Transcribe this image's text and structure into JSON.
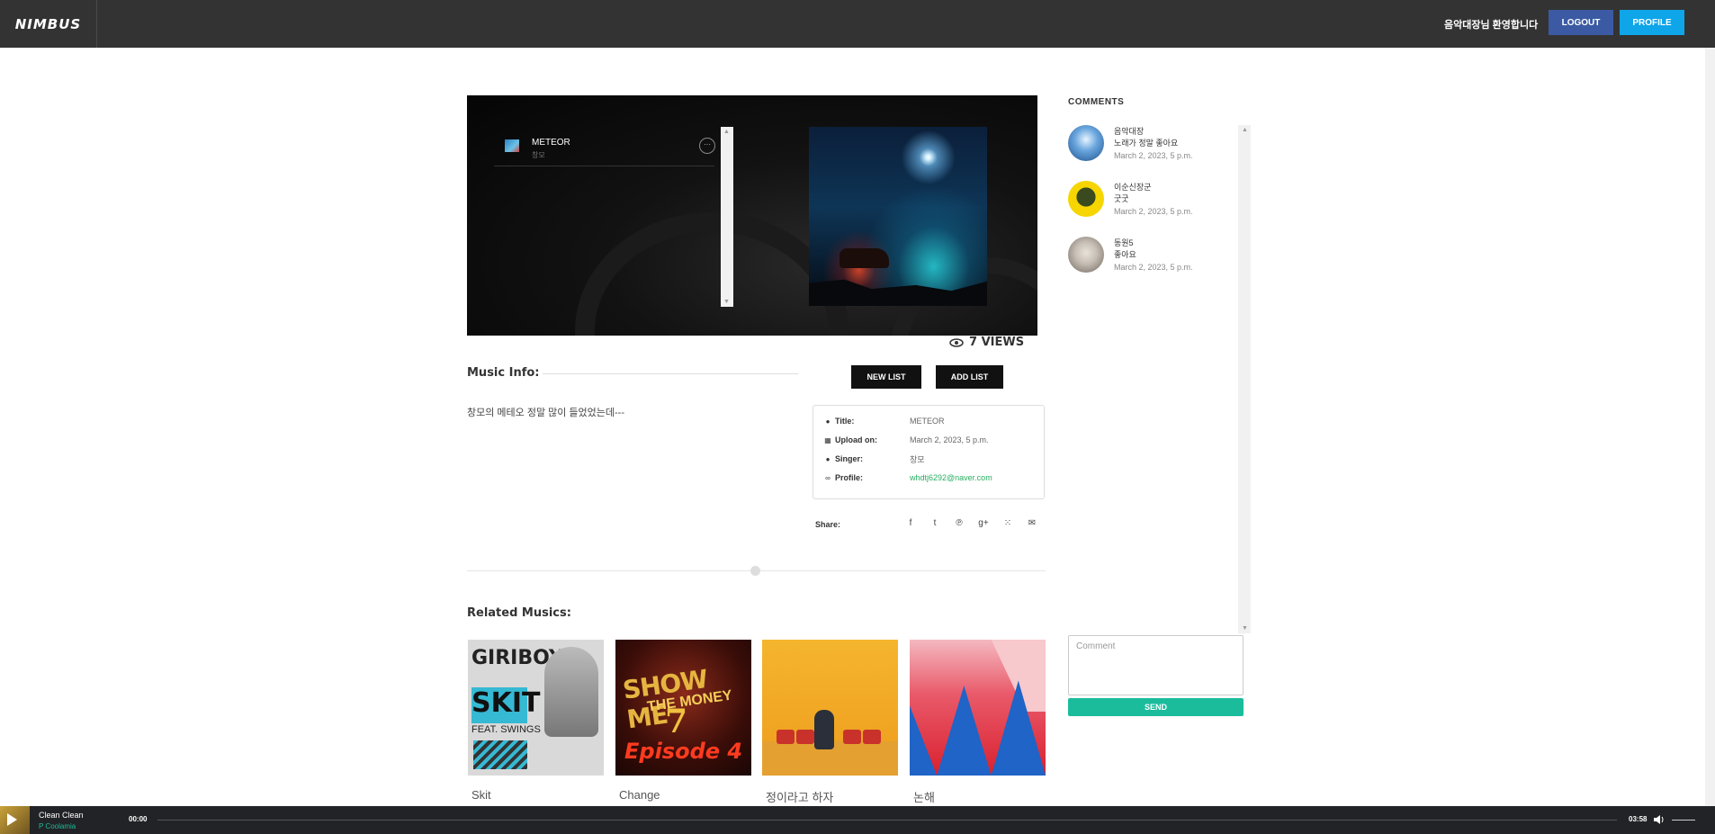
{
  "header": {
    "logo": "NIMBUS",
    "welcome": "음악대장님 환영합니다",
    "logout_label": "LOGOUT",
    "profile_label": "PROFILE"
  },
  "player_panel": {
    "playlist": [
      {
        "title": "METEOR",
        "artist": "창모",
        "more_label": "···"
      }
    ],
    "views": "7 VIEWS"
  },
  "music_info": {
    "heading": "Music Info:",
    "description": "창모의 메테오 정말 많이 들었었는데---",
    "new_list_label": "NEW LIST",
    "add_list_label": "ADD LIST",
    "details": [
      {
        "icon": "pin-icon",
        "glyph": "●",
        "key": "Title:",
        "value": "METEOR"
      },
      {
        "icon": "calendar-icon",
        "glyph": "▦",
        "key": "Upload on:",
        "value": "March 2, 2023, 5 p.m."
      },
      {
        "icon": "user-icon",
        "glyph": "●",
        "key": "Singer:",
        "value": "창모"
      },
      {
        "icon": "link-icon",
        "glyph": "∞",
        "key": "Profile:",
        "value": "whdtj6292@naver.com"
      }
    ],
    "share_label": "Share:",
    "share_icons": [
      {
        "name": "facebook-icon",
        "glyph": "f"
      },
      {
        "name": "twitter-icon",
        "glyph": "t"
      },
      {
        "name": "pinterest-icon",
        "glyph": "℗"
      },
      {
        "name": "google-plus-icon",
        "glyph": "g+"
      },
      {
        "name": "rss-icon",
        "glyph": "⁙"
      },
      {
        "name": "email-icon",
        "glyph": "✉"
      }
    ]
  },
  "related": {
    "heading": "Related Musics:",
    "items": [
      {
        "label": "Skit",
        "art_text": {
          "top": "GIRIBOY",
          "middle": "SKIT",
          "bottom": "FEAT. SWINGS"
        }
      },
      {
        "label": "Change",
        "art_text": {
          "top": "SHOW ME",
          "middle": "THE MONEY",
          "number": "7",
          "bottom": "Episode 4"
        }
      },
      {
        "label": "정이라고 하자"
      },
      {
        "label": "논해"
      }
    ]
  },
  "comments": {
    "heading": "COMMENTS",
    "items": [
      {
        "user": "음악대장",
        "text": "노래가 정말 좋아요",
        "date": "March 2, 2023, 5 p.m."
      },
      {
        "user": "이순신장군",
        "text": "굿굿",
        "date": "March 2, 2023, 5 p.m."
      },
      {
        "user": "동원5",
        "text": "좋아요",
        "date": "March 2, 2023, 5 p.m."
      }
    ],
    "input_placeholder": "Comment",
    "send_label": "SEND"
  },
  "now_playing": {
    "title": "Clean Clean",
    "artist": "P Coolamia",
    "current_time": "00:00",
    "duration": "03:58"
  }
}
